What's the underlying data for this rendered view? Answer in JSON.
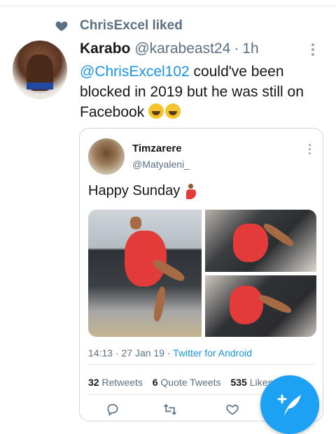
{
  "activity": {
    "liked_text": "ChrisExcel liked",
    "icon": "heart-icon"
  },
  "tweet": {
    "name": "Karabo",
    "handle": "@karabeast24",
    "separator": "·",
    "time": "1h",
    "mention": "@ChrisExcel102",
    "text": " could've been blocked in 2019 but he was still on Facebook"
  },
  "quoted": {
    "name": "Timzarere",
    "handle": "@Matyaleni_",
    "text": "Happy Sunday",
    "meta_time": "14:13 · 27 Jan 19 · ",
    "meta_app": "Twitter for Android",
    "stats": {
      "retweets_count": "32",
      "retweets_label": "Retweets",
      "quotes_count": "6",
      "quotes_label": "Quote Tweets",
      "likes_count": "535",
      "likes_label": "Likes"
    }
  },
  "colors": {
    "accent": "#1da1f2",
    "link": "#1b95e0",
    "muted": "#5b7083"
  }
}
